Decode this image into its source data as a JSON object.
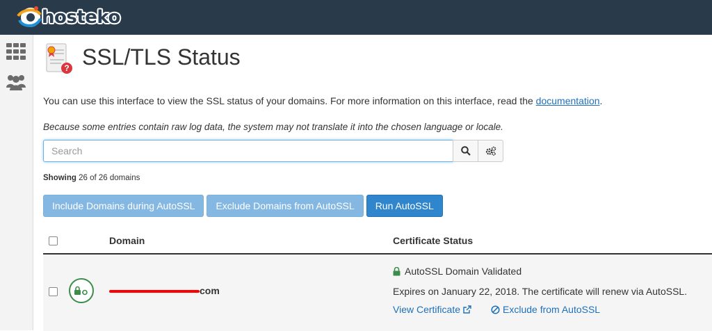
{
  "brand": {
    "name": "hosteko"
  },
  "sidebar": {
    "items": [
      {
        "icon": "grid-icon"
      },
      {
        "icon": "users-icon"
      }
    ]
  },
  "page": {
    "title": "SSL/TLS Status",
    "intro_text": "You can use this interface to view the SSL status of your domains. For more information on this interface, read the",
    "intro_link": "documentation",
    "intro_end": ".",
    "note": "Because some entries contain raw log data, the system may not translate it into the chosen language or locale."
  },
  "search": {
    "placeholder": "Search",
    "value": ""
  },
  "showing": {
    "label": "Showing",
    "text": "26 of 26 domains"
  },
  "actions": {
    "include_label": "Include Domains during AutoSSL",
    "exclude_label": "Exclude Domains from AutoSSL",
    "run_label": "Run AutoSSL"
  },
  "table": {
    "columns": {
      "domain": "Domain",
      "status": "Certificate Status"
    },
    "rows": [
      {
        "domain_suffix": "com",
        "status": "AutoSSL Domain Validated",
        "expires": "Expires on January 22, 2018. The certificate will renew via AutoSSL.",
        "view_link": "View Certificate",
        "exclude_link": "Exclude from AutoSSL"
      }
    ]
  },
  "colors": {
    "topbar": "#293a4a",
    "link": "#1e70b9",
    "primary": "#2f86cc",
    "secondary": "#84b8e2",
    "success": "#3c8d4a"
  }
}
